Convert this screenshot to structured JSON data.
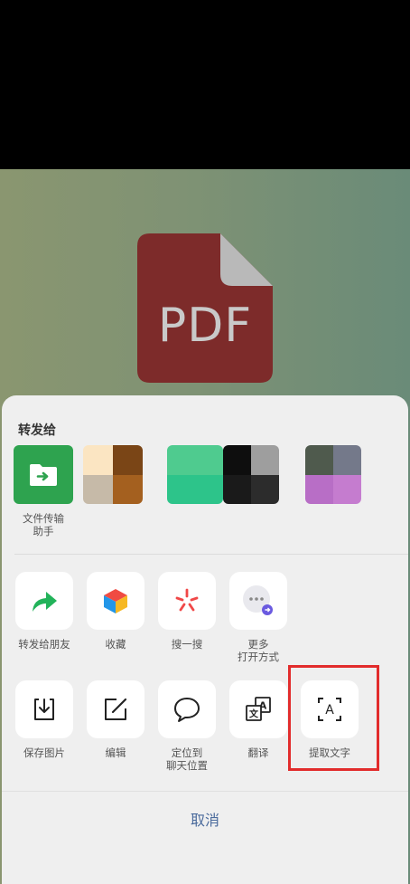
{
  "pdf_preview": {
    "text": "PDF"
  },
  "sheet": {
    "title": "转发给",
    "contacts": [
      {
        "name": "文件传输\n助手"
      },
      {
        "name": ""
      },
      {
        "name": ""
      },
      {
        "name": ""
      },
      {
        "name": ""
      }
    ],
    "actions_row1": [
      {
        "label": "转发给朋友",
        "icon": "forward-arrow-icon"
      },
      {
        "label": "收藏",
        "icon": "cube-icon"
      },
      {
        "label": "搜一搜",
        "icon": "search-star-icon"
      },
      {
        "label": "更多\n打开方式",
        "icon": "more-icon"
      }
    ],
    "actions_row2": [
      {
        "label": "保存图片",
        "icon": "save-download-icon"
      },
      {
        "label": "编辑",
        "icon": "edit-pencil-icon"
      },
      {
        "label": "定位到\n聊天位置",
        "icon": "chat-bubble-icon"
      },
      {
        "label": "翻译",
        "icon": "translate-icon"
      },
      {
        "label": "提取文字",
        "icon": "extract-text-icon"
      }
    ],
    "cancel_label": "取消"
  },
  "colors": {
    "accent_green": "#2ea34f",
    "highlight_red": "#e22c2c",
    "cancel_blue": "#4a6a9c"
  }
}
